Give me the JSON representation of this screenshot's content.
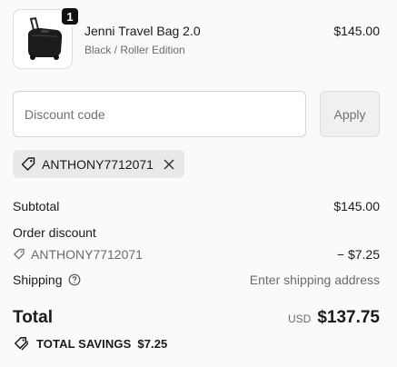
{
  "product": {
    "name": "Jenni Travel Bag 2.0",
    "variant": "Black / Roller Edition",
    "price": "$145.00",
    "quantity": "1",
    "image_icon": "rolling-bag-icon"
  },
  "discount": {
    "placeholder": "Discount code",
    "apply_label": "Apply",
    "applied_code": "ANTHONY7712071"
  },
  "summary": {
    "subtotal_label": "Subtotal",
    "subtotal_value": "$145.00",
    "order_discount_label": "Order discount",
    "order_discount_code": "ANTHONY7712071",
    "order_discount_value": "− $7.25",
    "shipping_label": "Shipping",
    "shipping_value": "Enter shipping address",
    "total_label": "Total",
    "total_currency": "USD",
    "total_value": "$137.75",
    "savings_label": "TOTAL SAVINGS",
    "savings_value": "$7.25"
  },
  "colors": {
    "background": "#fafafa",
    "text": "#1a1a1a",
    "muted": "#6b6b6b",
    "chip": "#e9e9e9"
  }
}
